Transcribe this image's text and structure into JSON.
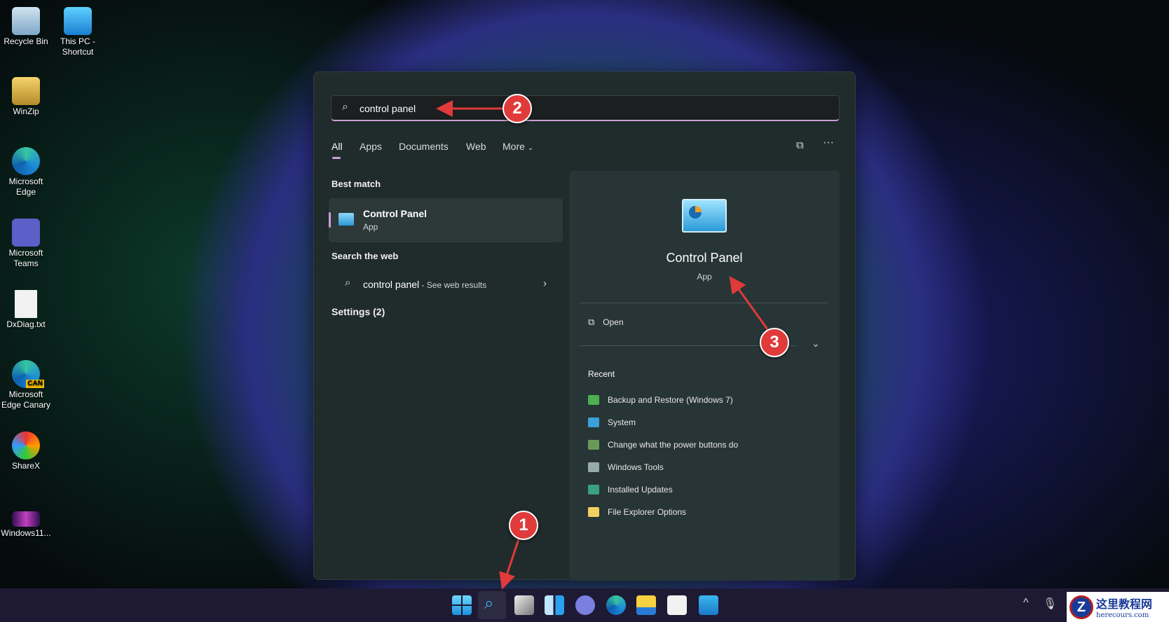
{
  "desktop": {
    "icons": [
      {
        "label": "Recycle Bin"
      },
      {
        "label": "This PC - Shortcut"
      },
      {
        "label": "WinZip"
      },
      {
        "label": "Microsoft Edge"
      },
      {
        "label": "Microsoft Teams"
      },
      {
        "label": "DxDiag.txt"
      },
      {
        "label": "Microsoft Edge Canary",
        "badge": "CAN"
      },
      {
        "label": "ShareX"
      },
      {
        "label": "Windows11..."
      }
    ]
  },
  "search": {
    "query": "control panel",
    "tabs": [
      "All",
      "Apps",
      "Documents",
      "Web",
      "More"
    ],
    "active_tab": "All"
  },
  "results": {
    "best_match_heading": "Best match",
    "best_match": {
      "title": "Control Panel",
      "subtitle": "App"
    },
    "web_heading": "Search the web",
    "web_item": {
      "query": "control panel",
      "suffix": " - See web results"
    },
    "settings_heading": "Settings (2)"
  },
  "detail": {
    "title": "Control Panel",
    "subtitle": "App",
    "open_label": "Open",
    "recent_heading": "Recent",
    "recent": [
      "Backup and Restore (Windows 7)",
      "System",
      "Change what the power buttons do",
      "Windows Tools",
      "Installed Updates",
      "File Explorer Options"
    ]
  },
  "annotations": [
    "1",
    "2",
    "3"
  ],
  "watermark": {
    "title": "这里教程网",
    "url": "herecours.com"
  },
  "colors": {
    "accent": "#c8a0d6",
    "annotation": "#e03a3a"
  }
}
